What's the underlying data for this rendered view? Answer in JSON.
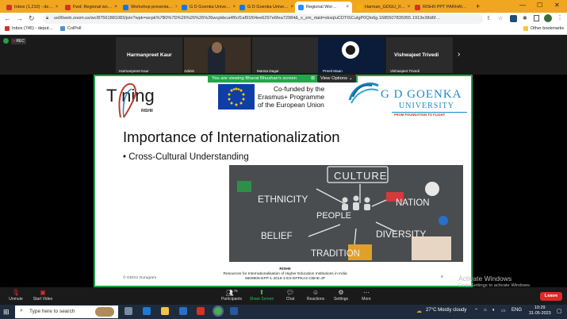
{
  "browser": {
    "tabs": [
      {
        "label": "Inbox (1,210) - de…",
        "color": "#d93025"
      },
      {
        "label": "Fwd: Regional wo…",
        "color": "#d93025"
      },
      {
        "label": "Workshop presenta…",
        "color": "#1a73e8"
      },
      {
        "label": "G D Goenka Unive…",
        "color": "#1a73e8"
      },
      {
        "label": "G D Goenka Unive…",
        "color": "#1a73e8"
      },
      {
        "label": "Regional Wor…",
        "color": "#2d8cff"
      },
      {
        "label": "Harman_GDGU_II…",
        "color": "#f4b400"
      },
      {
        "label": "RISHII PPT PARHAI…",
        "color": "#d93025"
      }
    ],
    "url": "us06web.zoom.us/wc/87561881083/join?wpk=wcpk%7B0%7D%26%26%26%26wcpkbca4f6cf1af91f04ee6297e6fea72984&_x_zm_rtaid=sksqIuCDTtSCuIgP0Qlo6g.1685507835955.1913e38d6f…",
    "bookmarks": {
      "inbox": "Inbox (745) - deput…",
      "colpoll": "ColPoll",
      "other": "Other bookmarks"
    }
  },
  "zoom": {
    "rec": "REC",
    "gallery": {
      "top_names": [
        "Harmanpreet Kaur",
        "Vishwajeet Trivedi"
      ],
      "labels": [
        "Harmanpreet Kaur",
        "Admin",
        "Mamta Dagar",
        "Preeti Maan",
        "Vishwajeet Trivedi"
      ]
    },
    "share_banner": "You are viewing Bharat Bhushan's screen",
    "view_options": "View Options",
    "controls": {
      "unmute": "Unmute",
      "start_video": "Start Video",
      "participants": "Participants",
      "participants_count": "76",
      "share_screen": "Share Screen",
      "chat": "Chat",
      "reactions": "Reactions",
      "settings": "Settings",
      "more": "More",
      "leave": "Leave"
    }
  },
  "slide": {
    "logo_text": "T  ning",
    "logo_sub": "RISHII",
    "erasmus_text": [
      "Co-funded by the",
      "Erasmus+ Programme",
      "of the European Union"
    ],
    "university": "G D GOENKA",
    "university_sub": "UNIVERSITY",
    "university_tag": "FROM FOUNDATION TO FLIGHT",
    "title": "Importance of Internationalization",
    "bullet": "Cross-Cultural Understanding",
    "chalk_words": [
      "CULTURE",
      "ETHNICITY",
      "PEOPLE",
      "NATION",
      "BELIEF",
      "DIVERSITY",
      "TRADITION"
    ],
    "footer_left": "© GDGU Gurugram",
    "footer_center": [
      "RISHII",
      "Resources for Internationalisation of Higher Education Institutions in India",
      "6609906-EPP-1-2019-1-ES-EPPKA2-CBHE-JP"
    ],
    "page_number": "9"
  },
  "windows": {
    "activate_title": "Activate Windows",
    "activate_sub": "Go to Settings to activate Windows.",
    "search_placeholder": "Type here to search",
    "weather": "27°C  Mostly cloudy",
    "lang": "ENG",
    "time": "10:29",
    "date": "31-05-2023"
  }
}
